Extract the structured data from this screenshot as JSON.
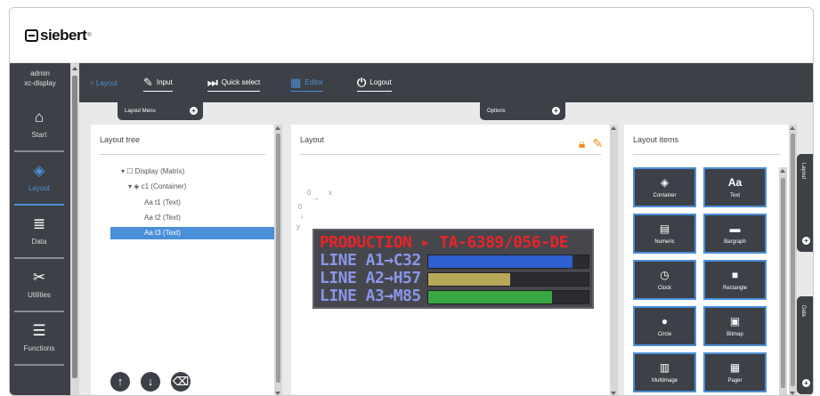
{
  "brand": {
    "name": "siebert",
    "reg": "®"
  },
  "user": {
    "name": "admin",
    "device": "xc-display"
  },
  "sidebar": {
    "items": [
      {
        "label": "Start",
        "icon": "home-icon",
        "glyph": "⌂"
      },
      {
        "label": "Layout",
        "icon": "layout-shapes-icon",
        "glyph": "◈"
      },
      {
        "label": "Data",
        "icon": "database-icon",
        "glyph": "≣"
      },
      {
        "label": "Utilities",
        "icon": "tools-icon",
        "glyph": "✂"
      },
      {
        "label": "Functions",
        "icon": "sliders-icon",
        "glyph": "☰"
      }
    ]
  },
  "topnav": {
    "breadcrumb": "> Layout",
    "input": "Input",
    "quick_select": "Quick select",
    "editor": "Editor",
    "logout": "Logout"
  },
  "tabs": {
    "layout_menu": "Layout Menu",
    "options": "Options"
  },
  "tree": {
    "title": "Layout tree",
    "rows": [
      {
        "label": "Display (Matrix)",
        "prefix": "▾ ☐"
      },
      {
        "label": "c1 (Container)",
        "prefix": "▾ ◈"
      },
      {
        "label": "t1 (Text)",
        "prefix": "Aa"
      },
      {
        "label": "t2 (Text)",
        "prefix": "Aa"
      },
      {
        "label": "t3 (Text)",
        "prefix": "Aa"
      }
    ]
  },
  "layout": {
    "title": "Layout",
    "axis_x": "x",
    "axis_y": "y",
    "origin_x": "0",
    "origin_y": "0",
    "led_lines": [
      "PRODUCTION ▸ TA-6389/056-DE",
      "LINE A1→C32",
      "LINE A2→H57",
      "LINE A3→M85"
    ],
    "bars": [
      {
        "fill": 0.9,
        "color": "#2f5fd0"
      },
      {
        "fill": 0.51,
        "color": "#b8a85a"
      },
      {
        "fill": 0.77,
        "color": "#3aa842"
      }
    ]
  },
  "items": {
    "title": "Layout items",
    "tiles": [
      {
        "label": "Container",
        "glyph": "◈"
      },
      {
        "label": "Text",
        "glyph": "Aa"
      },
      {
        "label": "Numeric",
        "glyph": "▤"
      },
      {
        "label": "Bargraph",
        "glyph": "▬"
      },
      {
        "label": "Clock",
        "glyph": "◷"
      },
      {
        "label": "Rectangle",
        "glyph": "■"
      },
      {
        "label": "Circle",
        "glyph": "●"
      },
      {
        "label": "Bitmap",
        "glyph": "▣"
      },
      {
        "label": "Multiimage",
        "glyph": "▥"
      },
      {
        "label": "Pager",
        "glyph": "▦"
      }
    ]
  },
  "right_tabs": {
    "layout": "Layout",
    "data": "Data"
  },
  "colors": {
    "accent": "#4a8fd8",
    "dark": "#3d4046",
    "orange": "#f08c1e",
    "led_red": "#e8242a",
    "led_blue": "#8b96e8"
  }
}
